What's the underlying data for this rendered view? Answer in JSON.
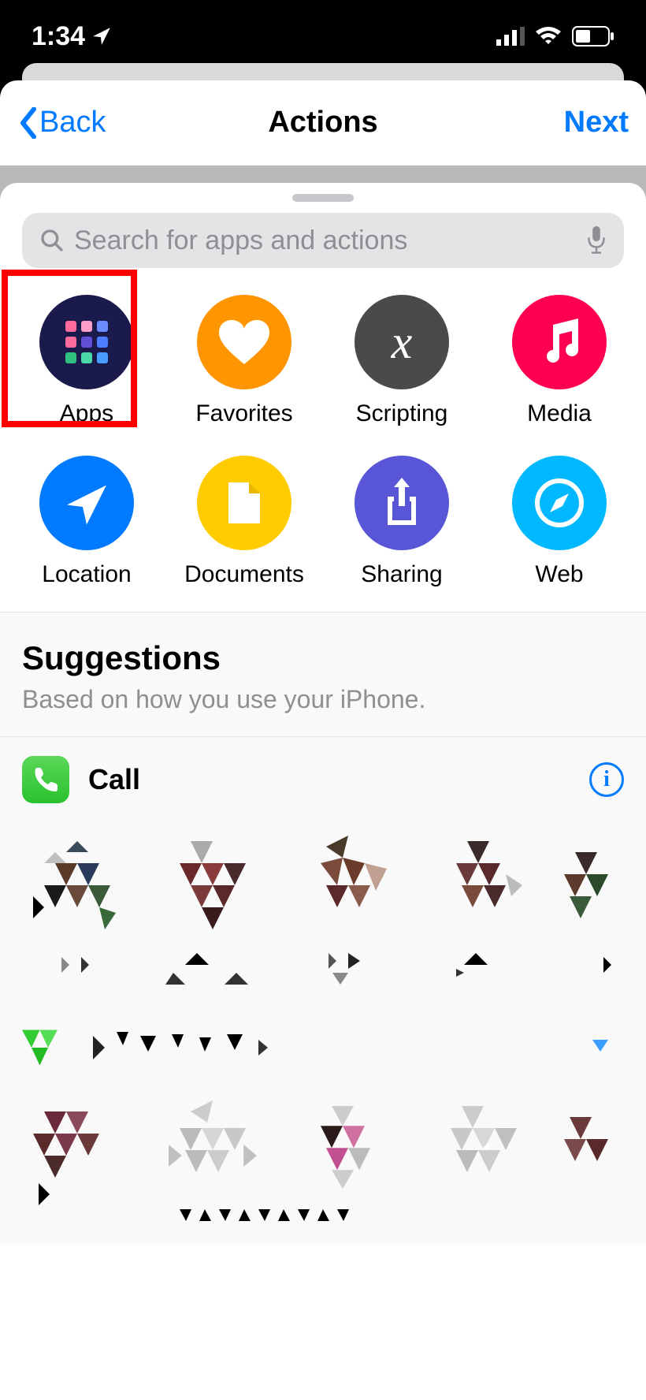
{
  "status": {
    "time": "1:34"
  },
  "nav": {
    "back": "Back",
    "title": "Actions",
    "next": "Next"
  },
  "search": {
    "placeholder": "Search for apps and actions"
  },
  "categories": [
    {
      "id": "apps",
      "label": "Apps",
      "bg": "#1a1a4d",
      "highlighted": true
    },
    {
      "id": "favorites",
      "label": "Favorites",
      "bg": "#ff9500"
    },
    {
      "id": "scripting",
      "label": "Scripting",
      "bg": "#4a4a4a"
    },
    {
      "id": "media",
      "label": "Media",
      "bg": "#ff0050"
    },
    {
      "id": "location",
      "label": "Location",
      "bg": "#007aff"
    },
    {
      "id": "documents",
      "label": "Documents",
      "bg": "#ffcc00"
    },
    {
      "id": "sharing",
      "label": "Sharing",
      "bg": "#5856d6"
    },
    {
      "id": "web",
      "label": "Web",
      "bg": "#00b8ff"
    }
  ],
  "suggestions": {
    "title": "Suggestions",
    "subtitle": "Based on how you use your iPhone.",
    "call_label": "Call"
  }
}
